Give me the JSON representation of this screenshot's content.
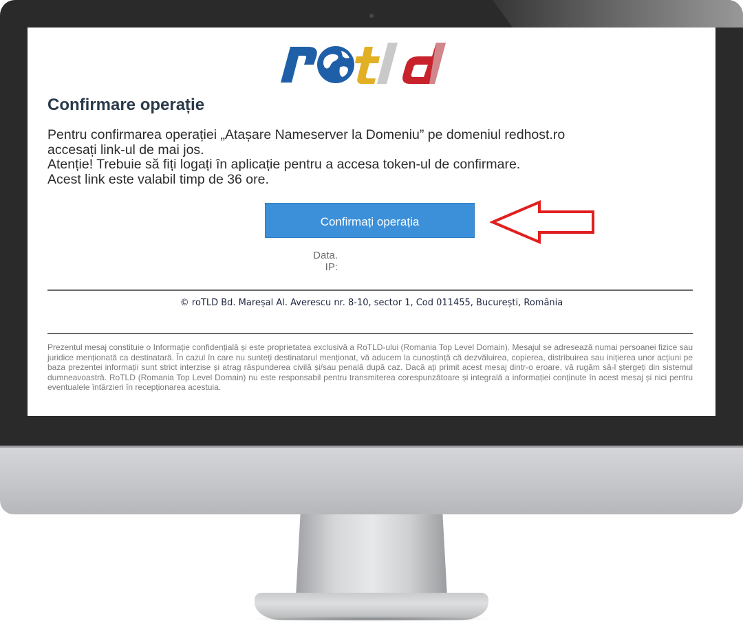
{
  "brand": {
    "logo_text": "rotld",
    "accent": "#1f5fa8",
    "logo_gold": "#e2b024",
    "logo_red": "#c8232c"
  },
  "email": {
    "title": "Confirmare operație",
    "body_line1_left": "Pentru confirmarea operației „Atașare Nameserver la Domeniu” pe domeniul redhost.ro",
    "body_line2": "accesați link-ul de mai jos.",
    "body_line3": "Atenție! Trebuie să fiți logați în aplicație pentru a accesa token-ul de confirmare.",
    "body_line4": "Acest link este valabil timp de 36 ore.",
    "confirm_button": "Confirmați operația",
    "meta_data_label": "Data.",
    "meta_ip_label": "IP:",
    "footer_address": "© roTLD Bd. Mareșal Al. Averescu nr. 8-10, sector 1, Cod 011455, București, România",
    "legal_notice": "Prezentul mesaj constituie o Informație confidențială și este proprietatea exclusivă a RoTLD-ului (Romania Top Level Domain). Mesajul se adresează numai persoanei fizice sau juridice menționată ca destinatară. În cazul în care nu sunteți destinatarul menționat, vă aducem la cunoștință că dezvăluirea, copierea, distribuirea sau inițierea unor acțiuni pe baza prezentei informații sunt strict interzise și atrag răspunderea civilă și/sau penală după caz. Dacă ați primit acest mesaj dintr-o eroare, vă rugăm să-l ștergeți din sistemul dumneavoastră. RoTLD (Romania Top Level Domain) nu este responsabil pentru transmiterea corespunzătoare și integrală a informației conținute în acest mesaj și nici pentru eventualele întârzieri în recepționarea acestuia."
  },
  "annotation": {
    "arrow_color": "#e0201f"
  },
  "colors": {
    "button_bg": "#3c90d9",
    "title": "#2a3a4a"
  }
}
